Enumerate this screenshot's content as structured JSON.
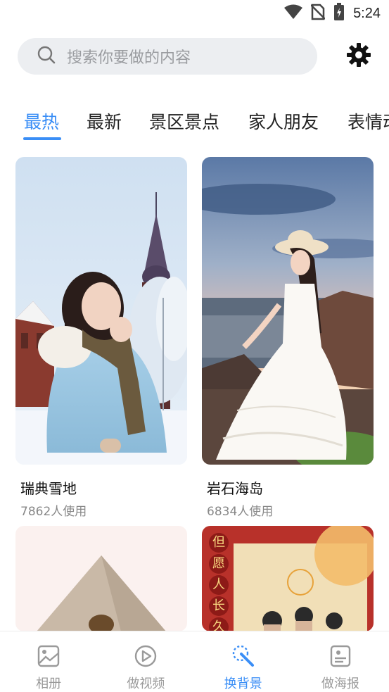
{
  "status_bar": {
    "time": "5:24",
    "icons": [
      "wifi-icon",
      "no-sim-icon",
      "battery-charging-icon"
    ]
  },
  "search": {
    "placeholder": "搜索你要做的内容",
    "icon": "search-icon"
  },
  "settings": {
    "icon": "gear-icon"
  },
  "tabs": [
    {
      "label": "最热",
      "active": true
    },
    {
      "label": "最新",
      "active": false
    },
    {
      "label": "景区景点",
      "active": false
    },
    {
      "label": "家人朋友",
      "active": false
    },
    {
      "label": "表情动",
      "active": false
    }
  ],
  "cards": [
    {
      "title": "瑞典雪地",
      "usage": "7862人使用"
    },
    {
      "title": "岩石海岛",
      "usage": "6834人使用"
    },
    {
      "title": "",
      "usage": ""
    },
    {
      "title": "",
      "usage": ""
    }
  ],
  "poster_text": [
    "但",
    "愿",
    "人",
    "长",
    "久"
  ],
  "bottom_nav": [
    {
      "label": "相册",
      "icon": "album-icon",
      "active": false
    },
    {
      "label": "做视频",
      "icon": "play-circle-icon",
      "active": false
    },
    {
      "label": "换背景",
      "icon": "magic-wand-icon",
      "active": true
    },
    {
      "label": "做海报",
      "icon": "poster-icon",
      "active": false
    }
  ],
  "colors": {
    "accent": "#3a8ef6",
    "search_bg": "#eceef1",
    "inactive_text": "#9a9a9a"
  }
}
